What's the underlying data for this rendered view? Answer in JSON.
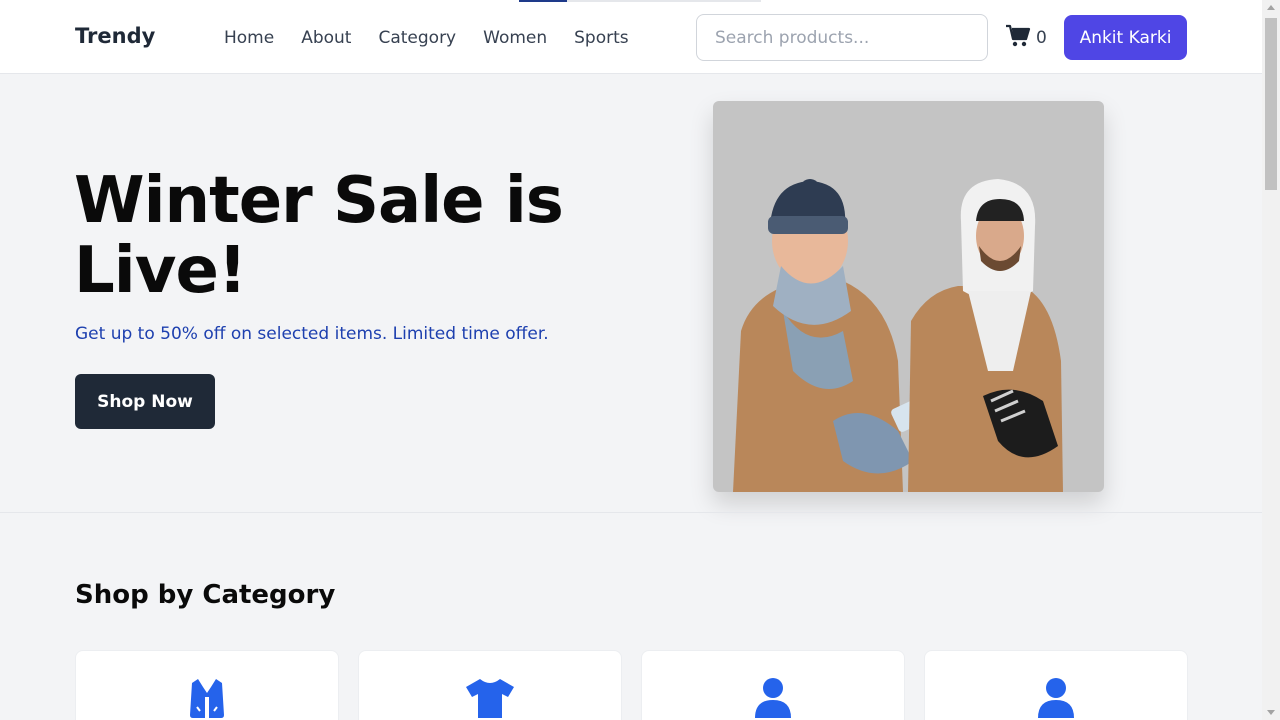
{
  "header": {
    "logo": "Trendy",
    "nav": [
      "Home",
      "About",
      "Category",
      "Women",
      "Sports"
    ],
    "search_placeholder": "Search products...",
    "cart_count": "0",
    "user_label": "Ankit Karki",
    "progress_fraction": 0.2
  },
  "hero": {
    "title": "Winter Sale is Live!",
    "subtitle": "Get up to 50% off on selected items. Limited time offer.",
    "cta_label": "Shop Now"
  },
  "categories": {
    "title": "Shop by Category",
    "icons": [
      "vest-icon",
      "tshirt-icon",
      "user-icon",
      "user-icon"
    ]
  },
  "colors": {
    "primary": "#4f46e5",
    "dark_button": "#1f2937",
    "subtitle": "#1e40af",
    "category_icon": "#2563eb"
  }
}
